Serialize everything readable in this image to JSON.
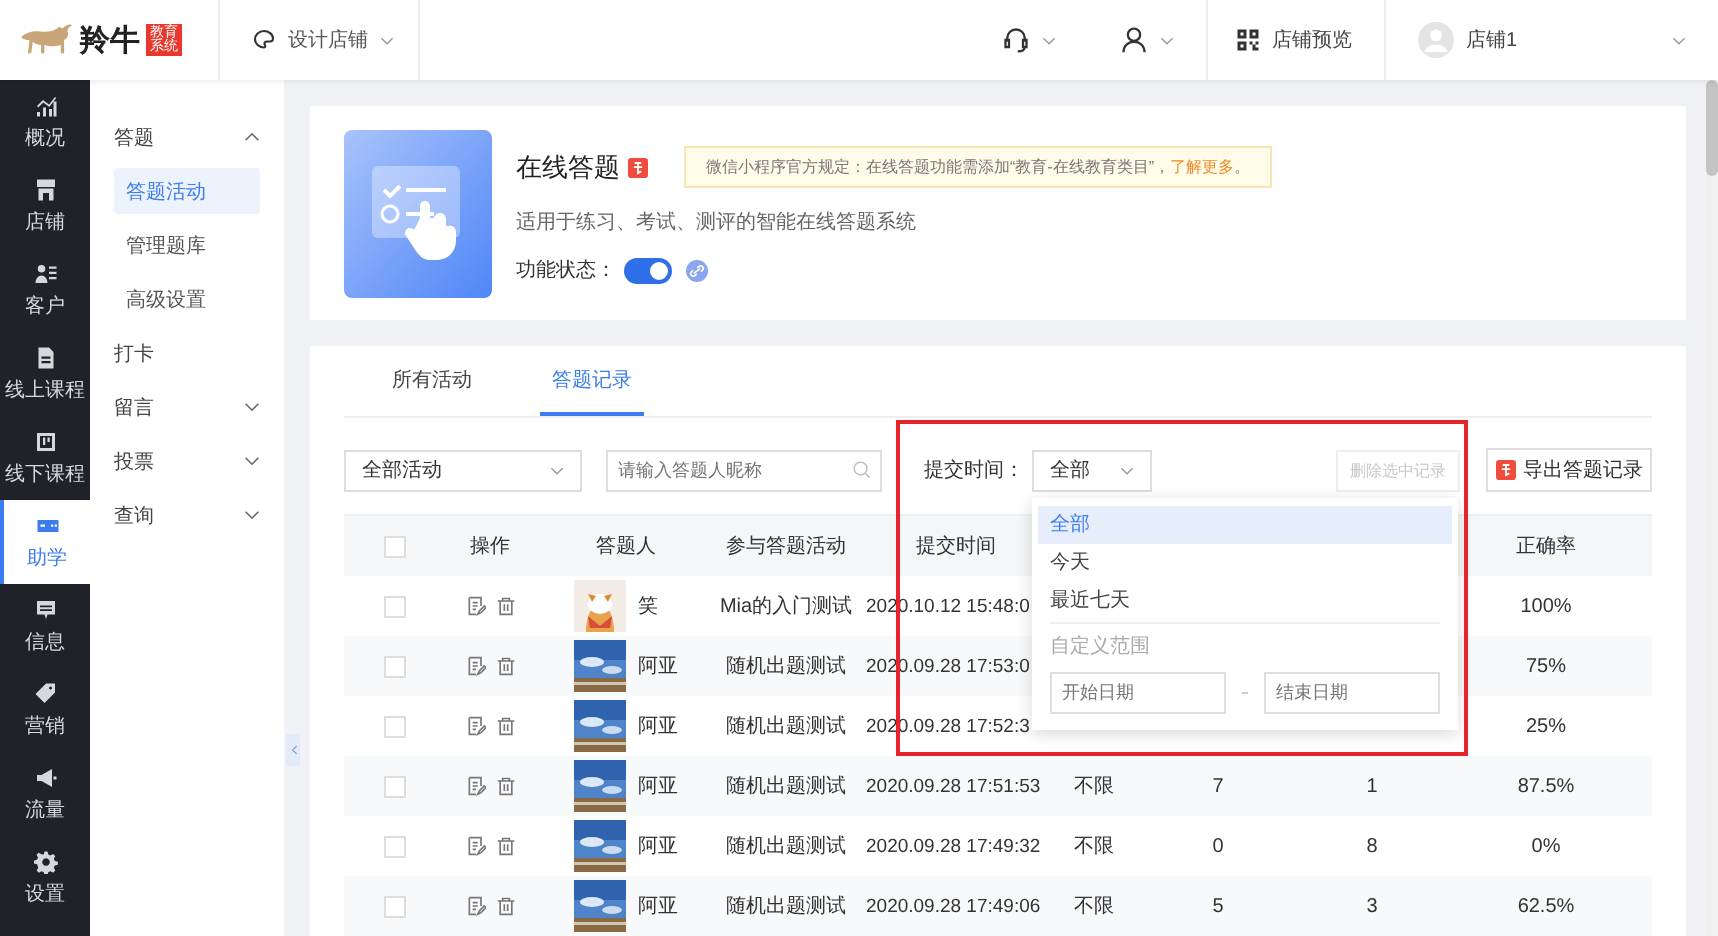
{
  "header": {
    "logo_text": "羚牛",
    "logo_badge": "教育系统",
    "shop_switch": "设计店铺",
    "shop_switch_open": false,
    "preview": "店铺预览",
    "user": "店铺1"
  },
  "nav": [
    {
      "label": "概况",
      "selected": false
    },
    {
      "label": "店铺",
      "selected": false
    },
    {
      "label": "客户",
      "selected": false
    },
    {
      "label": "线上课程",
      "selected": false
    },
    {
      "label": "线下课程",
      "selected": false
    },
    {
      "label": "助学",
      "selected": true
    },
    {
      "label": "信息",
      "selected": false
    },
    {
      "label": "营销",
      "selected": false
    },
    {
      "label": "流量",
      "selected": false
    },
    {
      "label": "设置",
      "selected": false
    }
  ],
  "subnav": [
    {
      "label": "答题",
      "expanded": true,
      "children": [
        {
          "label": "答题活动",
          "selected": true
        },
        {
          "label": "管理题库",
          "selected": false
        },
        {
          "label": "高级设置",
          "selected": false
        }
      ]
    },
    {
      "label": "打卡"
    },
    {
      "label": "留言",
      "expanded": false
    },
    {
      "label": "投票",
      "expanded": false
    },
    {
      "label": "查询",
      "expanded": false
    }
  ],
  "feature": {
    "title": "在线答题",
    "notice": "微信小程序官方规定：在线答题功能需添加“教育-在线教育类目”，",
    "notice_link": "了解更多",
    "notice_end": "。",
    "description": "适用于练习、考试、测评的智能在线答题系统",
    "status_label": "功能状态：",
    "status_on": true
  },
  "tabs": [
    {
      "label": "所有活动",
      "selected": false
    },
    {
      "label": "答题记录",
      "selected": true
    }
  ],
  "filters": {
    "activity": "全部活动",
    "search_placeholder": "请输入答题人昵称",
    "time_label": "提交时间：",
    "time_value": "全部",
    "delete_button": {
      "label": "删除选中记录",
      "disabled": true
    },
    "export_button": "导出答题记录"
  },
  "time_dropdown": {
    "options": [
      {
        "label": "全部",
        "selected": true
      },
      {
        "label": "今天",
        "selected": false
      },
      {
        "label": "最近七天",
        "selected": false
      }
    ],
    "custom_label": "自定义范围",
    "start_placeholder": "开始日期",
    "end_placeholder": "结束日期"
  },
  "table": {
    "all_checked": false,
    "columns": [
      "操作",
      "答题人",
      "参与答题活动",
      "提交时间",
      "正确率"
    ],
    "rows": [
      {
        "checked": false,
        "name": "笑",
        "activity": "Mia的入门测试",
        "time": "2020.10.12 15:48:0",
        "rate": "100%"
      },
      {
        "checked": false,
        "name": "阿亚",
        "activity": "随机出题测试",
        "time": "2020.09.28 17:53:0",
        "rate": "75%"
      },
      {
        "checked": false,
        "name": "阿亚",
        "activity": "随机出题测试",
        "time": "2020.09.28 17:52:3",
        "rate": "25%"
      },
      {
        "checked": false,
        "name": "阿亚",
        "activity": "随机出题测试",
        "time": "2020.09.28 17:51:53",
        "column_6": "不限",
        "column_7": "7",
        "column_8": "1",
        "rate": "87.5%"
      },
      {
        "checked": false,
        "name": "阿亚",
        "activity": "随机出题测试",
        "time": "2020.09.28 17:49:32",
        "column_6": "不限",
        "column_7": "0",
        "column_8": "8",
        "rate": "0%"
      },
      {
        "checked": false,
        "name": "阿亚",
        "activity": "随机出题测试",
        "time": "2020.09.28 17:49:06",
        "column_6": "不限",
        "column_7": "5",
        "column_8": "3",
        "rate": "62.5%"
      }
    ]
  }
}
